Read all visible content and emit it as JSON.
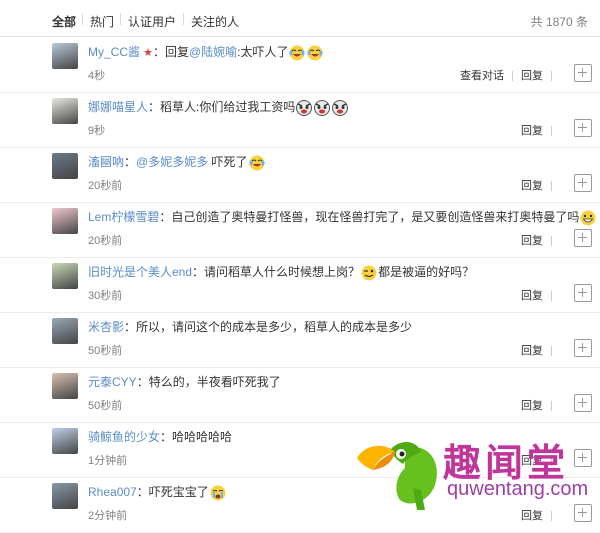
{
  "tabs": [
    {
      "label": "全部",
      "active": true
    },
    {
      "label": "热门",
      "active": false
    },
    {
      "label": "认证用户",
      "active": false
    },
    {
      "label": "关注的人",
      "active": false
    }
  ],
  "total": "共 1870 条",
  "action_labels": {
    "view_conversation": "查看对话",
    "reply": "回复"
  },
  "comments": [
    {
      "user": "My_CC酱",
      "reply_prefix": "：回复",
      "mention": "@陆婉喻",
      "text": ":太吓人了",
      "time": "4秒",
      "emoticons": [
        "laugh-cry",
        "laugh-cry"
      ],
      "has_view": true,
      "has_star": true
    },
    {
      "user": "娜娜喵星人",
      "reply_prefix": "：",
      "mention": "",
      "text": "稻草人:你们给过我工资吗",
      "time": "9秒",
      "emoticons": [
        "doge-angry",
        "doge-angry",
        "doge-angry"
      ],
      "has_view": false
    },
    {
      "user": "滀圝吶",
      "reply_prefix": "：",
      "mention": "@多妮多妮多",
      "text": " 吓死了",
      "time": "20秒前",
      "emoticons": [
        "laugh-cry"
      ],
      "has_view": false
    },
    {
      "user": "Lem柠檬雪碧",
      "reply_prefix": "：",
      "mention": "",
      "text": "自己创造了奥特曼打怪兽，现在怪兽打完了，是又要创造怪兽来打奥特曼了吗",
      "time": "20秒前",
      "emoticons": [
        "grin"
      ],
      "has_view": false
    },
    {
      "user": "旧时光是个美人end",
      "reply_prefix": "：",
      "mention": "",
      "text": "请问稻草人什么时候想上岗？",
      "text2": "都是被逼的好吗？",
      "time": "30秒前",
      "emoticons": [
        "wink"
      ],
      "has_view": false
    },
    {
      "user": "米杏影",
      "reply_prefix": "：",
      "mention": "",
      "text": "所以，请问这个的成本是多少，稻草人的成本是多少",
      "time": "50秒前",
      "emoticons": [],
      "has_view": false
    },
    {
      "user": "元泰CYY",
      "reply_prefix": "：",
      "mention": "",
      "text": "特么的，半夜看吓死我了",
      "time": "50秒前",
      "emoticons": [],
      "has_view": false
    },
    {
      "user": "骑鲸鱼的少女",
      "reply_prefix": "：",
      "mention": "",
      "text": "哈哈哈哈哈",
      "time": "1分钟前",
      "emoticons": [],
      "has_view": false
    },
    {
      "user": "Rhea007",
      "reply_prefix": "：",
      "mention": "",
      "text": "吓死宝宝了",
      "time": "2分钟前",
      "emoticons": [
        "cry"
      ],
      "has_view": false
    }
  ],
  "watermark": {
    "chinese": "趣闻堂",
    "url": "quwentang.com"
  },
  "colors": {
    "link": "#5a8cc8",
    "emoticon": "#f7d23e",
    "watermark": "#c0359a"
  }
}
